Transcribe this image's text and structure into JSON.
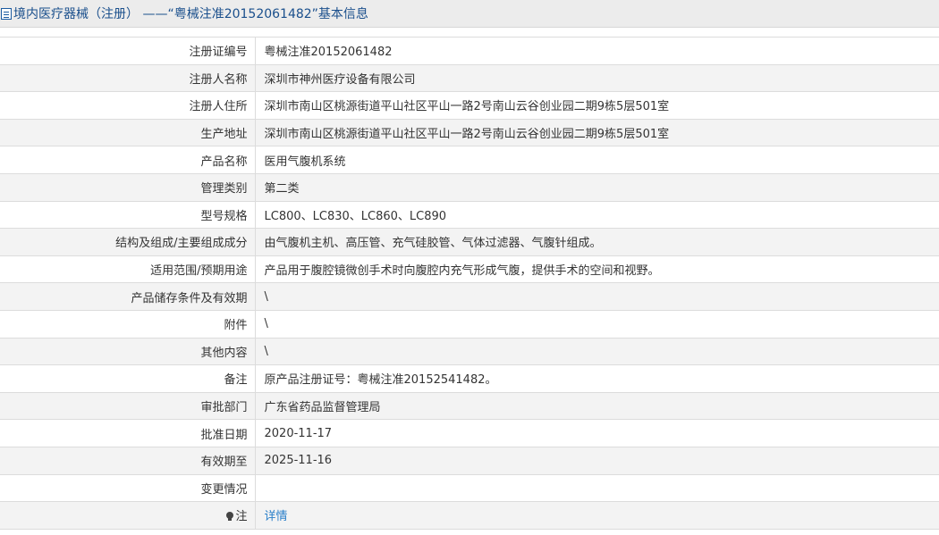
{
  "header": {
    "title": "境内医疗器械（注册） ——“粤械注准20152061482”基本信息"
  },
  "rows": [
    {
      "label": "注册证编号",
      "value": "粤械注准20152061482"
    },
    {
      "label": "注册人名称",
      "value": "深圳市神州医疗设备有限公司"
    },
    {
      "label": "注册人住所",
      "value": "深圳市南山区桃源街道平山社区平山一路2号南山云谷创业园二期9栋5层501室"
    },
    {
      "label": "生产地址",
      "value": "深圳市南山区桃源街道平山社区平山一路2号南山云谷创业园二期9栋5层501室"
    },
    {
      "label": "产品名称",
      "value": "医用气腹机系统"
    },
    {
      "label": "管理类别",
      "value": "第二类"
    },
    {
      "label": "型号规格",
      "value": "LC800、LC830、LC860、LC890"
    },
    {
      "label": "结构及组成/主要组成成分",
      "value": "由气腹机主机、高压管、充气硅胶管、气体过滤器、气腹针组成。"
    },
    {
      "label": "适用范围/预期用途",
      "value": "产品用于腹腔镜微创手术时向腹腔内充气形成气腹，提供手术的空间和视野。"
    },
    {
      "label": "产品储存条件及有效期",
      "value": "\\"
    },
    {
      "label": "附件",
      "value": "\\"
    },
    {
      "label": "其他内容",
      "value": "\\"
    },
    {
      "label": "备注",
      "value": "原产品注册证号：粤械注准20152541482。"
    },
    {
      "label": "审批部门",
      "value": "广东省药品监督管理局"
    },
    {
      "label": "批准日期",
      "value": "2020-11-17"
    },
    {
      "label": "有效期至",
      "value": "2025-11-16"
    },
    {
      "label": "变更情况",
      "value": ""
    }
  ],
  "note_row": {
    "label": "注",
    "link": "详情",
    "icon": "bulb-icon"
  },
  "colors": {
    "title": "#1a4f8c",
    "link": "#2a7fc9",
    "row_alt": "#f3f3f3",
    "border": "#dcdcdc"
  }
}
